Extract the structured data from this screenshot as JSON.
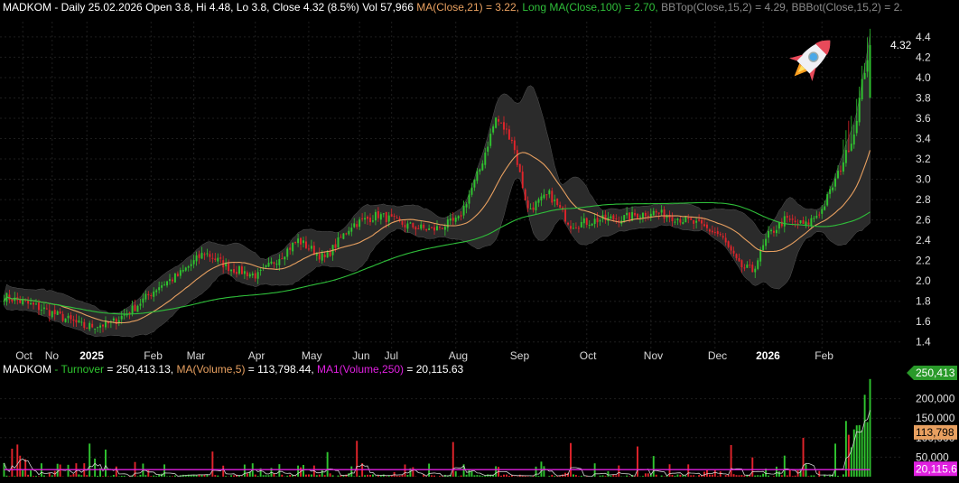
{
  "price_header": {
    "symbol": "MADKOM",
    "info": " - Daily 25.02.2026 Open 3.8, Hi 4.48, Lo 3.8, Close 4.32 (8.5%) Vol 57,966 ",
    "ma_label": "MA(Close,21) = 3.22,",
    "long_ma_label": " Long MA(Close,100) = 2.70,",
    "bbtop_label": " BBTop(Close,15,2) = 4.29,",
    "bbbot_label": " BBBot(Close,15,2) = 2."
  },
  "volume_header": {
    "symbol": "MADKOM",
    "turnover_label": " - Turnover",
    "turnover_value": " = 250,413.13,",
    "ma5_label": " MA(Volume,5)",
    "ma5_value": " = 113,798.44,",
    "ma250_label": " MA1(Volume,250)",
    "ma250_value": " = 20,115.63"
  },
  "colors": {
    "background": "#000000",
    "up": "#2fc42f",
    "down": "#e0242b",
    "ma21": "#e8a060",
    "long_ma": "#2fbf3a",
    "bands_fill": "#2b2b2b",
    "grid": "#1e1e1e",
    "turnover_line": "#d0d0d0",
    "ma250_line": "#e020e0"
  },
  "rocket_icon": "rocket-emoji",
  "chart_data": [
    {
      "type": "candlestick",
      "title": "MADKOM - Daily",
      "last_close_label": "4.32",
      "ylim": [
        1.3,
        4.55
      ],
      "y_ticks": [
        "1.4",
        "1.6",
        "1.8",
        "2.0",
        "2.2",
        "2.4",
        "2.6",
        "2.8",
        "3.0",
        "3.2",
        "3.4",
        "3.6",
        "3.8",
        "4.0",
        "4.2",
        "4.4"
      ],
      "x_ticks": [
        "Oct",
        "No",
        "2025",
        "Feb",
        "Mar",
        "Apr",
        "May",
        "Jun",
        "Jul",
        "Aug",
        "Sep",
        "Oct",
        "Nov",
        "Dec",
        "2026",
        "Feb"
      ],
      "bold_x_ticks": [
        "2025",
        "2026"
      ],
      "anchors": [
        [
          0,
          1.85
        ],
        [
          15,
          1.72
        ],
        [
          30,
          1.55
        ],
        [
          40,
          1.58
        ],
        [
          48,
          1.72
        ],
        [
          58,
          1.95
        ],
        [
          65,
          2.05
        ],
        [
          75,
          2.28
        ],
        [
          85,
          2.12
        ],
        [
          95,
          2.05
        ],
        [
          110,
          2.4
        ],
        [
          120,
          2.22
        ],
        [
          130,
          2.55
        ],
        [
          140,
          2.65
        ],
        [
          150,
          2.55
        ],
        [
          160,
          2.5
        ],
        [
          170,
          2.6
        ],
        [
          178,
          3.1
        ],
        [
          184,
          3.6
        ],
        [
          190,
          3.4
        ],
        [
          196,
          2.7
        ],
        [
          204,
          2.85
        ],
        [
          212,
          2.55
        ],
        [
          222,
          2.6
        ],
        [
          232,
          2.62
        ],
        [
          242,
          2.68
        ],
        [
          252,
          2.62
        ],
        [
          260,
          2.55
        ],
        [
          268,
          2.45
        ],
        [
          275,
          2.15
        ],
        [
          280,
          2.1
        ],
        [
          286,
          2.45
        ],
        [
          292,
          2.6
        ],
        [
          300,
          2.55
        ],
        [
          306,
          2.7
        ],
        [
          312,
          3.05
        ],
        [
          318,
          3.45
        ],
        [
          321,
          3.95
        ],
        [
          324,
          4.32
        ]
      ],
      "series": [
        {
          "name": "MA(Close,21)",
          "value": 3.22
        },
        {
          "name": "Long MA(Close,100)",
          "value": 2.7
        },
        {
          "name": "BBTop(Close,15,2)",
          "value": 4.29
        },
        {
          "name": "BBBot(Close,15,2)",
          "value": 2
        }
      ],
      "last": {
        "open": 3.8,
        "high": 4.48,
        "low": 3.8,
        "close": 4.32,
        "change_pct": 8.5,
        "volume": 57966
      }
    },
    {
      "type": "bar",
      "title": "MADKOM - Turnover",
      "ylim": [
        0,
        250000
      ],
      "y_ticks": [
        "50,000",
        "100,000",
        "150,000",
        "200,000"
      ],
      "last_turnover_label": "250,413",
      "ma5_tag": "113,798",
      "ma250_tag": "20,115.6",
      "series": [
        {
          "name": "Turnover",
          "value": 250413.13
        },
        {
          "name": "MA(Volume,5)",
          "value": 113798.44
        },
        {
          "name": "MA1(Volume,250)",
          "value": 20115.63
        }
      ]
    }
  ]
}
